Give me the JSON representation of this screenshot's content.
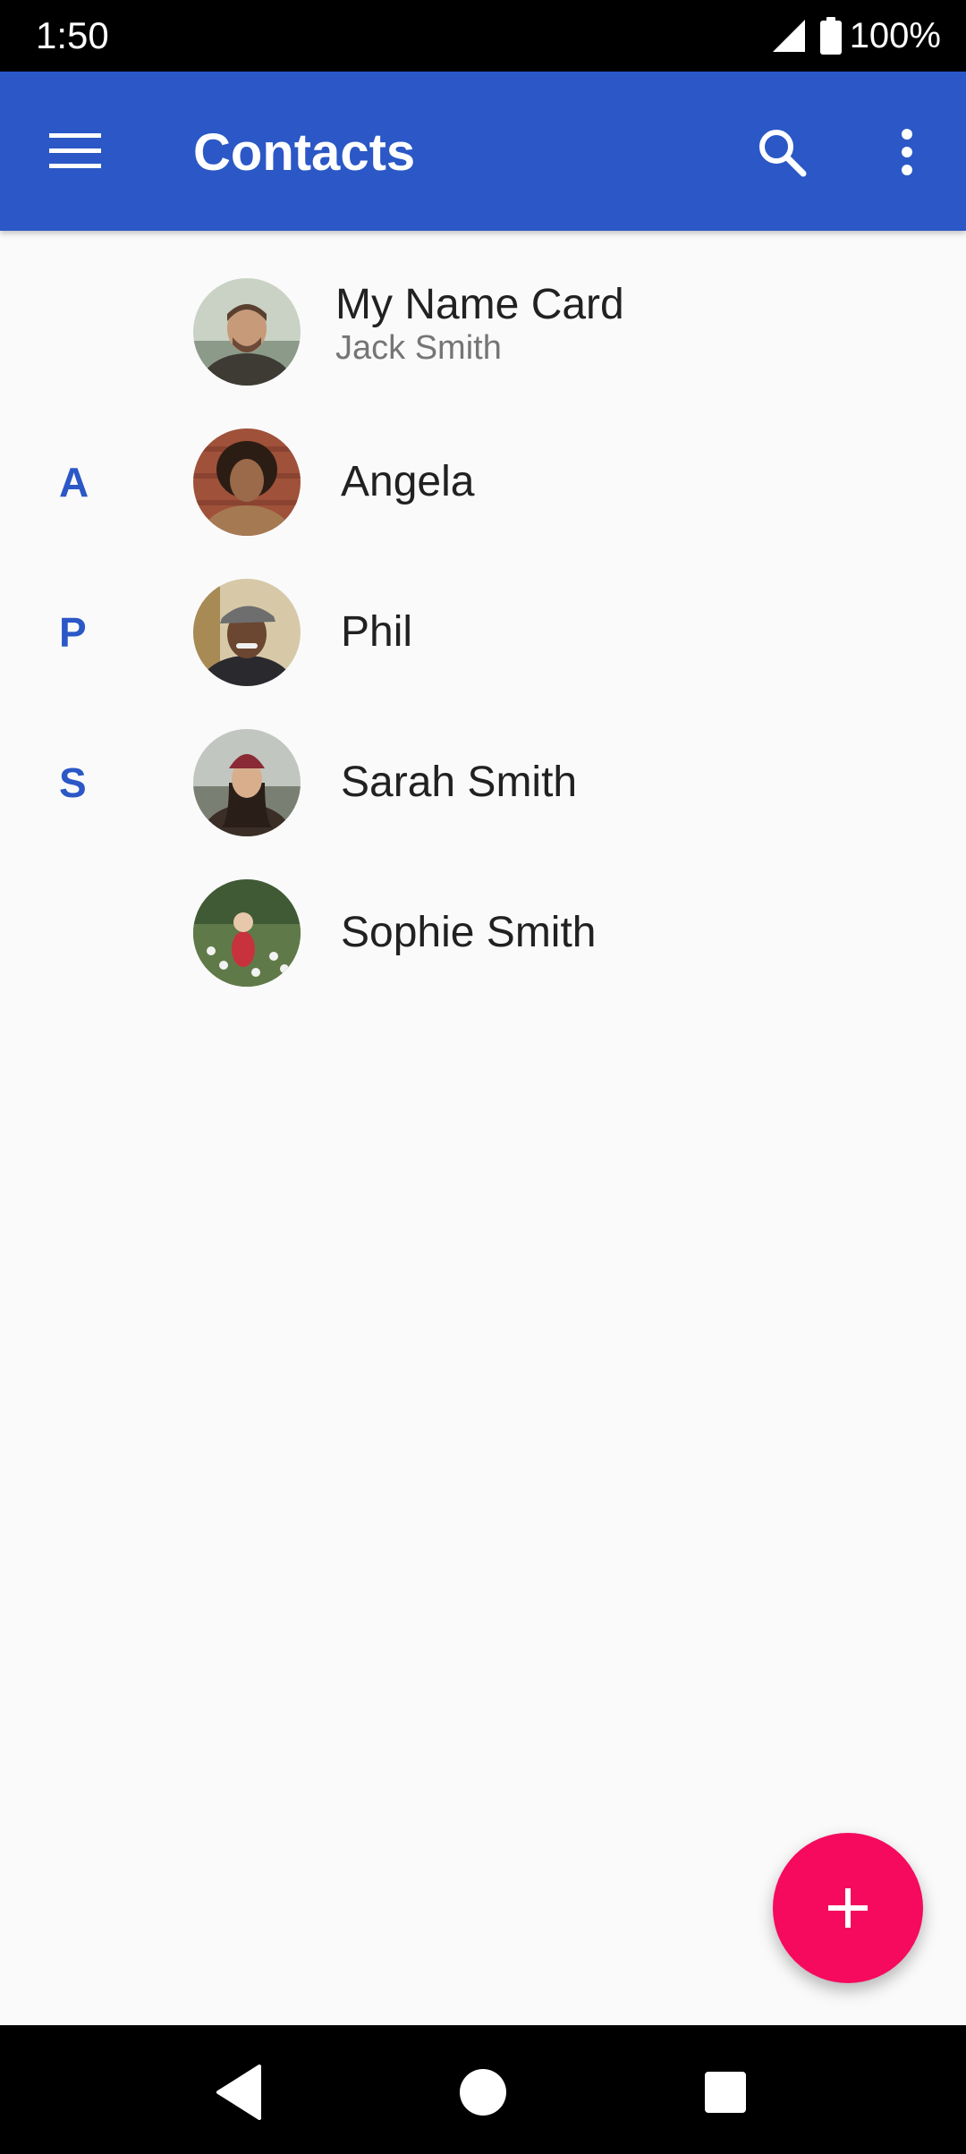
{
  "status_bar": {
    "time": "1:50",
    "battery": "100%",
    "icons": [
      "signal-icon",
      "battery-icon"
    ]
  },
  "app_bar": {
    "title": "Contacts",
    "icons": [
      "menu-icon",
      "search-icon",
      "more-vert-icon"
    ],
    "color": "#2b58c6"
  },
  "my_card": {
    "title": "My Name Card",
    "name": "Jack Smith"
  },
  "contacts": [
    {
      "letter": "A",
      "name": "Angela"
    },
    {
      "letter": "P",
      "name": "Phil"
    },
    {
      "letter": "S",
      "name": "Sarah Smith"
    },
    {
      "letter": "",
      "name": "Sophie Smith"
    }
  ],
  "fab": {
    "icon": "add-icon",
    "color": "#f50a5e"
  },
  "nav_bar": {
    "icons": [
      "back-icon",
      "home-icon",
      "recents-icon"
    ]
  }
}
